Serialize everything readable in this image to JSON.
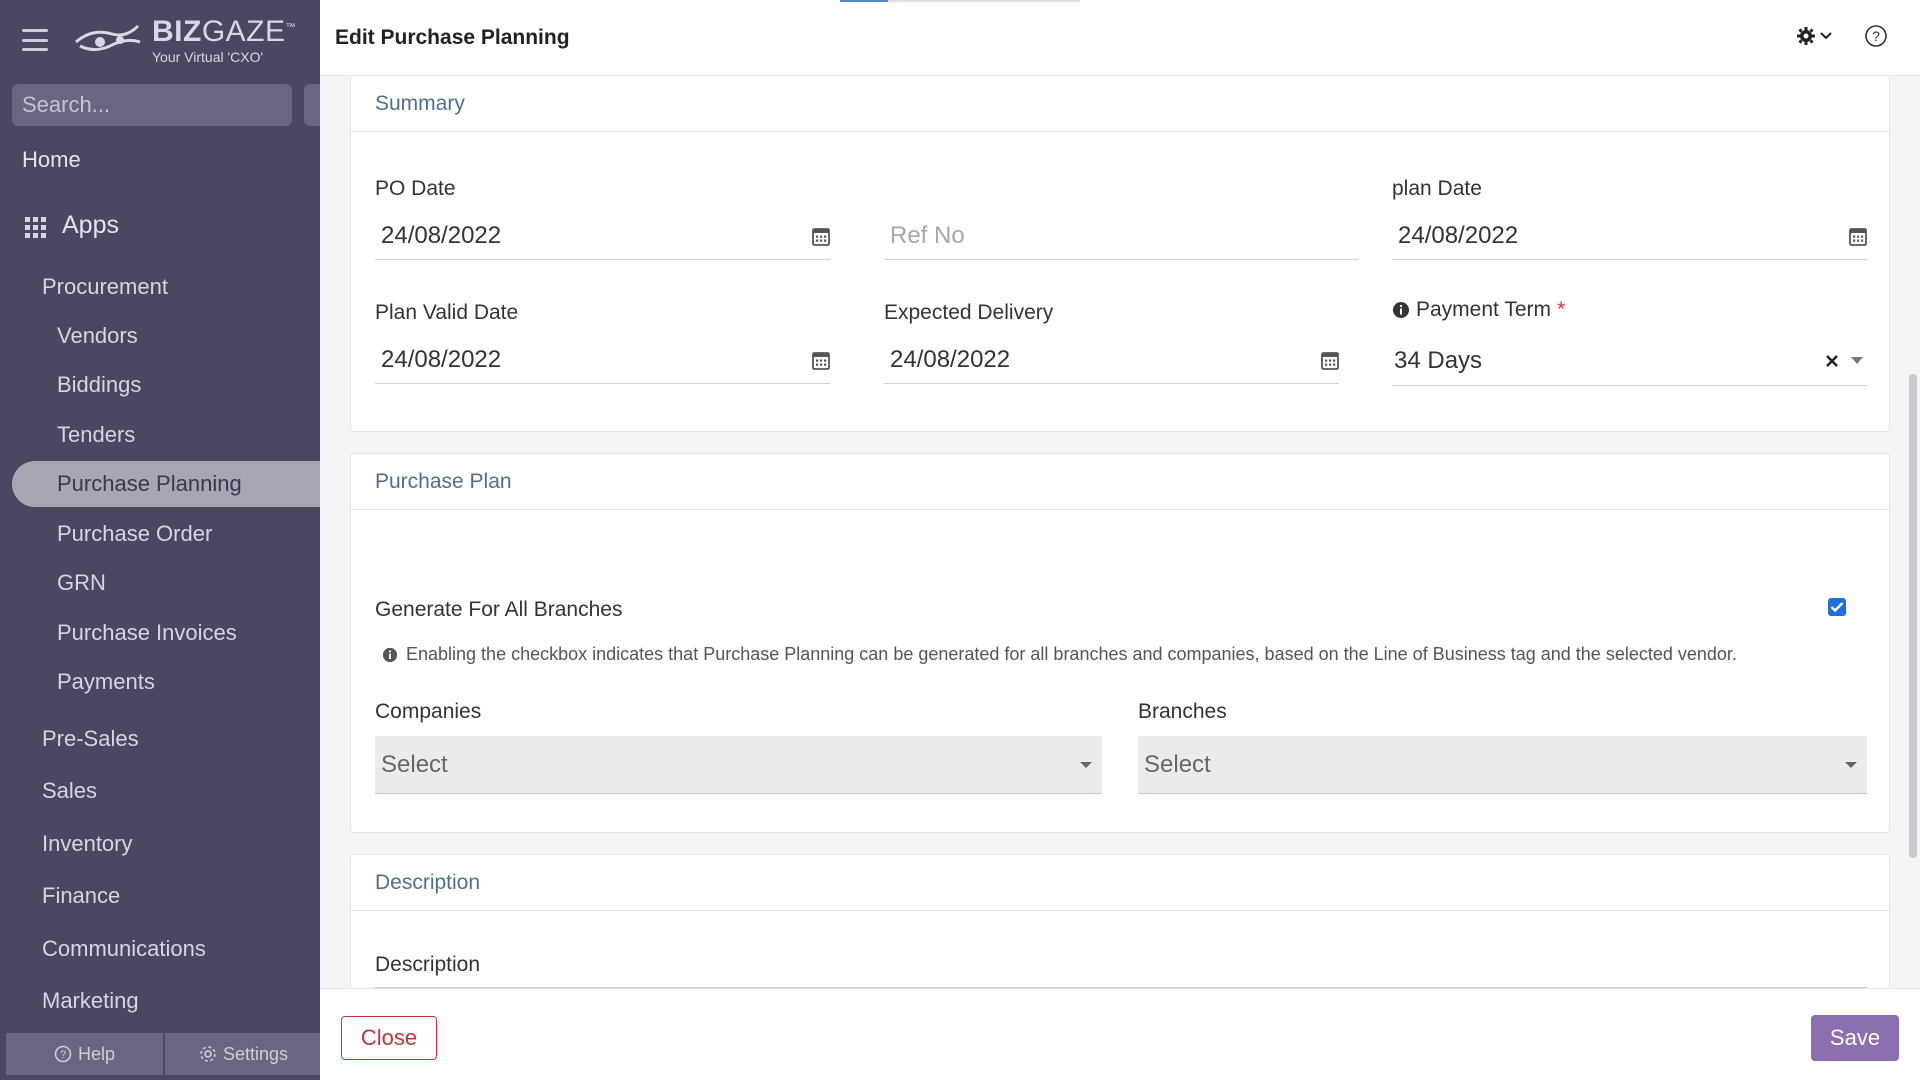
{
  "sidebar": {
    "logo": {
      "brand_bold": "BIZ",
      "brand_light": "GAZE",
      "trademark": "™",
      "tagline": "Your Virtual 'CXO'"
    },
    "search_placeholder": "Search...",
    "home_label": "Home",
    "apps_label": "Apps",
    "procurement_label": "Procurement",
    "procurement_items": [
      "Vendors",
      "Biddings",
      "Tenders",
      "Purchase Planning",
      "Purchase Order",
      "GRN",
      "Purchase Invoices",
      "Payments"
    ],
    "active_item": "Purchase Planning",
    "categories": [
      "Pre-Sales",
      "Sales",
      "Inventory",
      "Finance",
      "Communications",
      "Marketing"
    ],
    "footer": {
      "help_label": "Help",
      "settings_label": "Settings"
    }
  },
  "modal": {
    "title": "Edit Purchase Planning",
    "summary": {
      "heading": "Summary",
      "po_date_label": "PO Date",
      "po_date_value": "24/08/2022",
      "ref_no_placeholder": "Ref No",
      "plan_date_label": "plan Date",
      "plan_date_value": "24/08/2022",
      "plan_valid_date_label": "Plan Valid Date",
      "plan_valid_date_value": "24/08/2022",
      "expected_delivery_label": "Expected Delivery",
      "expected_delivery_value": "24/08/2022",
      "payment_term_label": "Payment Term",
      "payment_term_required": "*",
      "payment_term_value": "34 Days"
    },
    "purchase_plan": {
      "heading": "Purchase Plan",
      "generate_label": "Generate For All Branches",
      "generate_checked": true,
      "info_note": "Enabling the checkbox indicates that Purchase Planning can be generated for all branches and companies, based on the Line of Business tag and the selected vendor.",
      "companies_label": "Companies",
      "companies_value": "Select",
      "branches_label": "Branches",
      "branches_value": "Select"
    },
    "description": {
      "heading": "Description",
      "field_label": "Description"
    },
    "footer": {
      "close_label": "Close",
      "save_label": "Save"
    }
  },
  "colors": {
    "sidebar_bg": "#4c4663",
    "accent_purple": "#8c6fb0",
    "close_red": "#c8323a",
    "section_heading": "#4f6f8f",
    "checkbox_blue": "#1f6fe0"
  },
  "icons": [
    "hamburger-icon",
    "logo-icon",
    "search-icon",
    "apps-grid-icon",
    "help-circle-icon",
    "gear-icon",
    "chevron-down-icon",
    "question-icon",
    "calendar-icon",
    "info-icon",
    "clear-icon",
    "caret-down-icon",
    "checkbox-checked-icon"
  ]
}
